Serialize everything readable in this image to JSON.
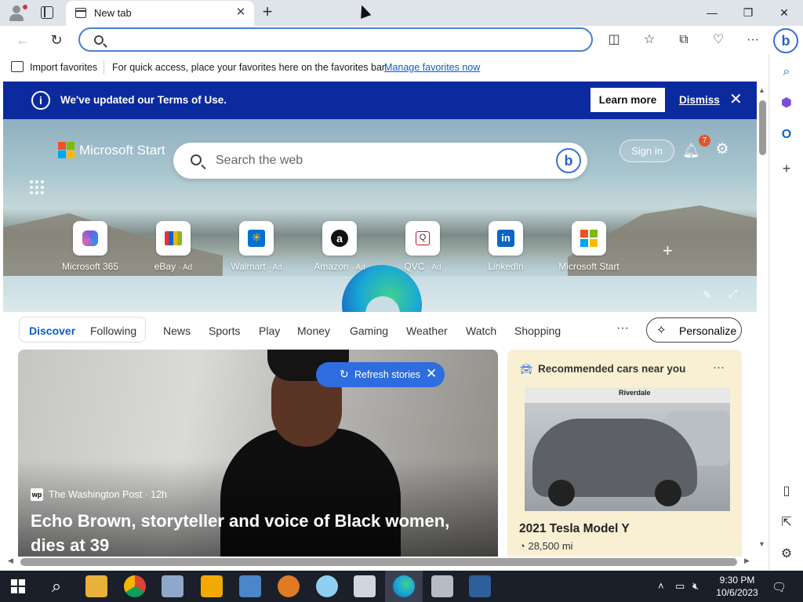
{
  "titlebar": {
    "tab_title": "New tab",
    "new_tab_symbol": "+",
    "minimize": "—",
    "maximize": "❐",
    "close": "✕"
  },
  "navbar": {
    "address_value": "",
    "address_placeholder": ""
  },
  "favbar": {
    "import_label": "Import favorites",
    "message": "For quick access, place your favorites here on the favorites bar.",
    "manage_link": "Manage favorites now"
  },
  "banner": {
    "text": "We've updated our Terms of Use.",
    "learn_more": "Learn more",
    "dismiss": "Dismiss"
  },
  "header": {
    "brand": "Microsoft Start",
    "search_placeholder": "Search the web",
    "sign_in": "Sign in",
    "notification_count": "7"
  },
  "quicklinks": [
    {
      "label": "Microsoft 365",
      "ad": ""
    },
    {
      "label": "eBay",
      "ad": "· Ad"
    },
    {
      "label": "Walmart",
      "ad": "· Ad"
    },
    {
      "label": "Amazon",
      "ad": "· Ad"
    },
    {
      "label": "QVC",
      "ad": "· Ad"
    },
    {
      "label": "LinkedIn",
      "ad": ""
    },
    {
      "label": "Microsoft Start",
      "ad": ""
    }
  ],
  "feed": {
    "discover": "Discover",
    "following": "Following",
    "tabs": [
      "News",
      "Sports",
      "Play",
      "Money",
      "Gaming",
      "Weather",
      "Watch",
      "Shopping"
    ],
    "more": "···",
    "personalize": "Personalize"
  },
  "story": {
    "source_logo": "wp",
    "source": "The Washington Post · 12h",
    "headline": "Echo Brown, storyteller and voice of Black women, dies at 39"
  },
  "refresh": {
    "label": "Refresh stories"
  },
  "card": {
    "title": "Recommended cars near you",
    "sign_text": "Riverdale",
    "model": "2021 Tesla Model Y",
    "miles": "28,500 mi"
  },
  "taskbar": {
    "time": "9:30 PM",
    "date": "10/6/2023"
  },
  "colors": {
    "banner": "#0b2a9e",
    "accent": "#0b5cc8",
    "refresh": "#2e6de0",
    "card_bg": "#f9f0d4",
    "taskbar": "#1b1f2a"
  }
}
